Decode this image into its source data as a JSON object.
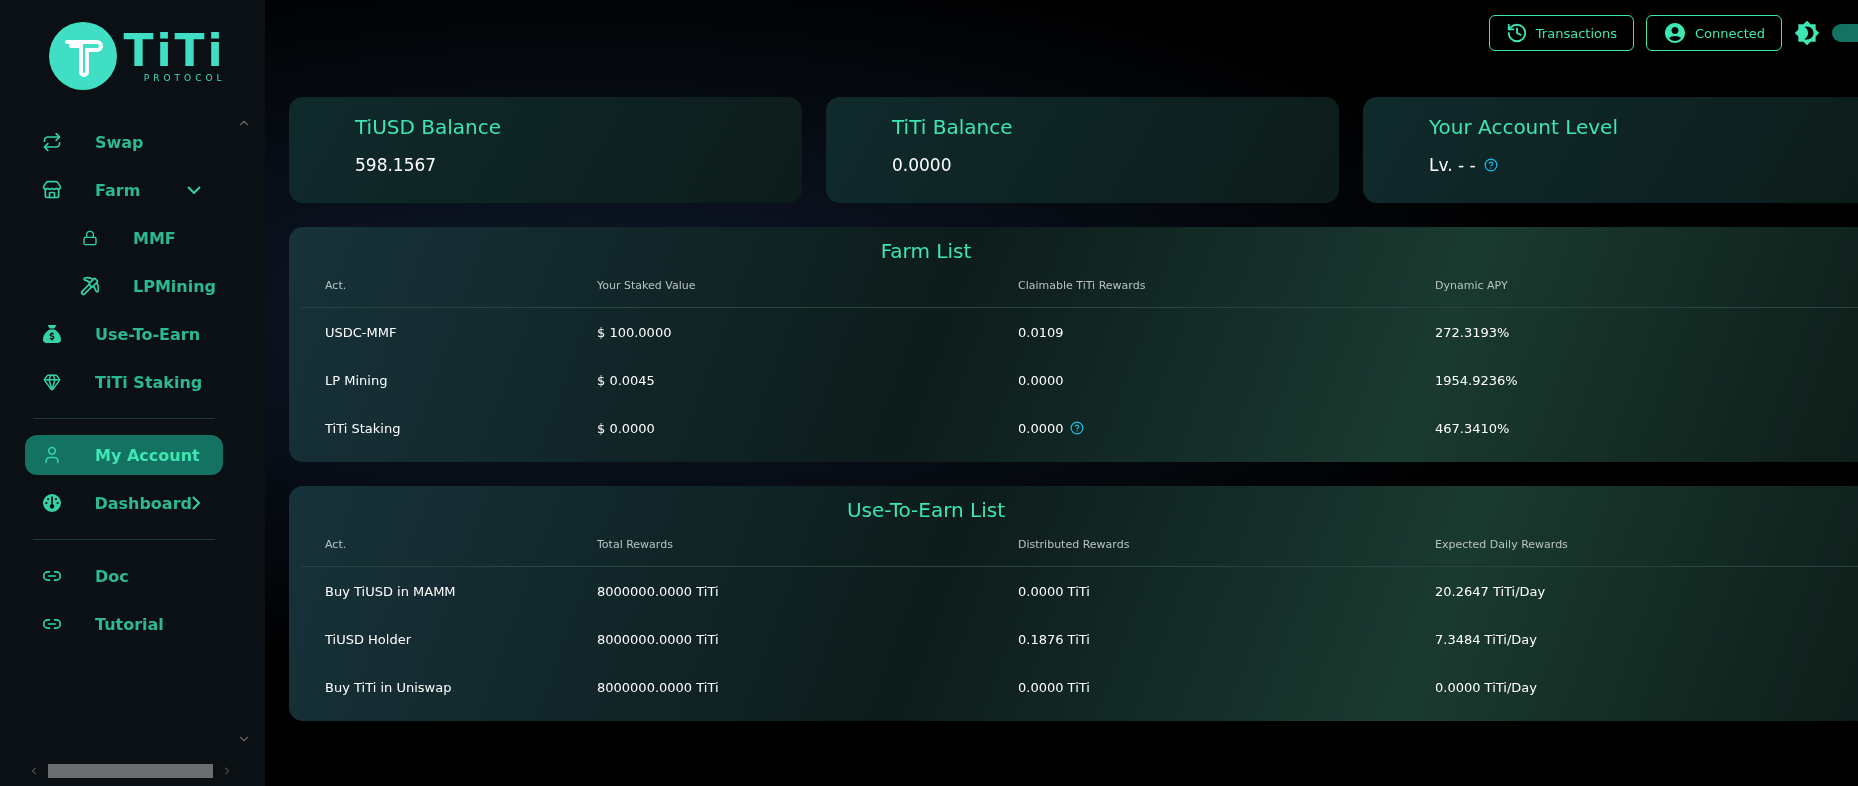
{
  "logo": {
    "name": "TiTi",
    "tagline": "PROTOCOL"
  },
  "sidebar": {
    "groups": [
      [
        {
          "label": "Swap",
          "selected": false
        },
        {
          "label": "Farm",
          "selected": false,
          "expanded": true,
          "children": [
            {
              "label": "MMF",
              "selected": false
            },
            {
              "label": "LPMining",
              "selected": false
            }
          ]
        },
        {
          "label": "Use-To-Earn",
          "selected": false
        },
        {
          "label": "TiTi Staking",
          "selected": false
        }
      ],
      [
        {
          "label": "My Account",
          "selected": true
        },
        {
          "label": "Dashboard",
          "selected": false,
          "expanded": false
        }
      ],
      [
        {
          "label": "Doc",
          "selected": false
        },
        {
          "label": "Tutorial",
          "selected": false
        }
      ]
    ]
  },
  "header": {
    "buttons": [
      "Transactions",
      "Connected"
    ],
    "theme_toggle": {
      "on": true
    }
  },
  "cards": [
    {
      "title": "TiUSD Balance",
      "value": "598.1567"
    },
    {
      "title": "TiTi Balance",
      "value": "0.0000"
    },
    {
      "title": "Your Account Level",
      "value": "Lv. - -",
      "help": true
    }
  ],
  "tables": [
    {
      "title": "Farm List",
      "columns": [
        "Act.",
        "Your Staked Value",
        "Claimable TiTi Rewards",
        "Dynamic APY"
      ],
      "rows": [
        {
          "cells": [
            "USDC-MMF",
            "$ 100.0000",
            "0.0109",
            "272.3193%"
          ],
          "help": false
        },
        {
          "cells": [
            "LP Mining",
            "$ 0.0045",
            "0.0000",
            "1954.9236%"
          ],
          "help": false
        },
        {
          "cells": [
            "TiTi Staking",
            "$ 0.0000",
            "0.0000",
            "467.3410%"
          ],
          "help": true
        }
      ]
    },
    {
      "title": "Use-To-Earn List",
      "columns": [
        "Act.",
        "Total Rewards",
        "Distributed Rewards",
        "Expected Daily Rewards"
      ],
      "rows": [
        {
          "cells": [
            "Buy TiUSD in MAMM",
            "8000000.0000 TiTi",
            "0.0000 TiTi",
            "20.2647 TiTi/Day"
          ],
          "help": false
        },
        {
          "cells": [
            "TiUSD Holder",
            "8000000.0000 TiTi",
            "0.1876 TiTi",
            "7.3484 TiTi/Day"
          ],
          "help": false
        },
        {
          "cells": [
            "Buy TiTi in Uniswap",
            "8000000.0000 TiTi",
            "0.0000 TiTi",
            "0.0000 TiTi/Day"
          ],
          "help": false
        }
      ]
    }
  ]
}
